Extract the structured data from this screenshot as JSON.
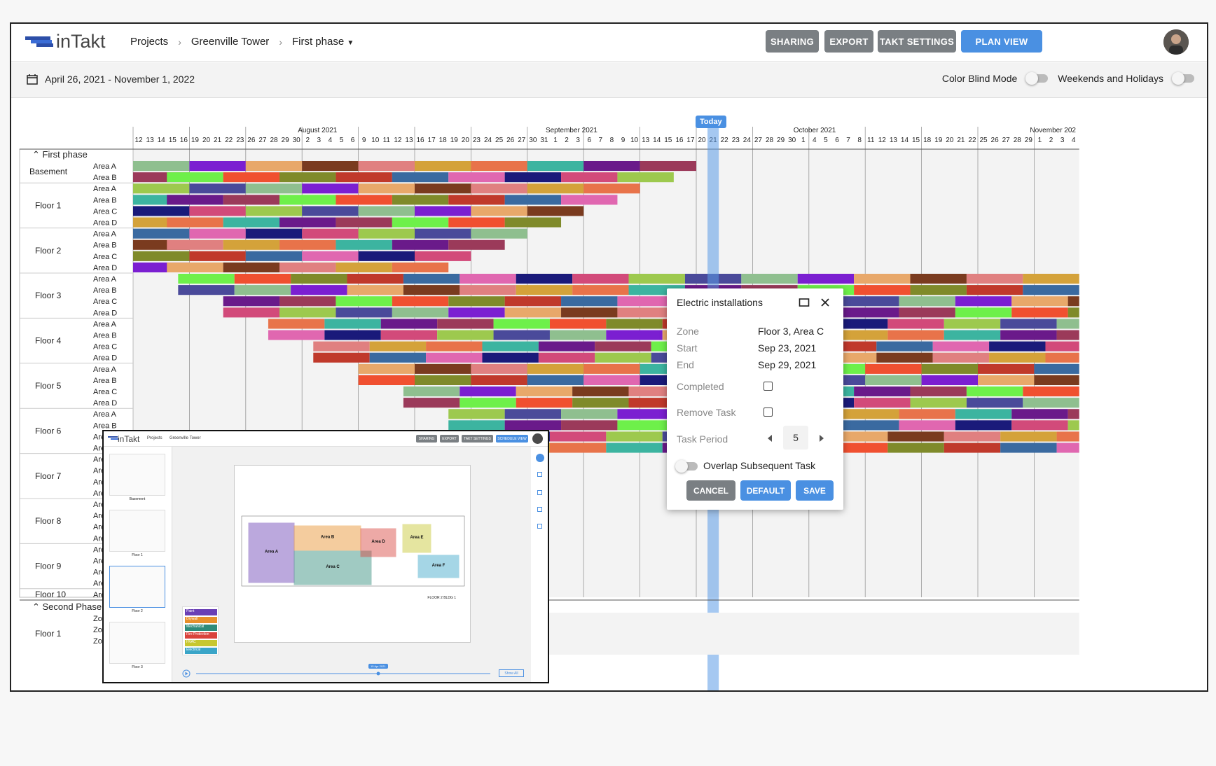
{
  "app": {
    "logo_text": "inTakt"
  },
  "breadcrumb": {
    "projects": "Projects",
    "project": "Greenville Tower",
    "phase": "First phase"
  },
  "header_buttons": {
    "sharing": "SHARING",
    "export": "EXPORT",
    "takt_settings": "TAKT SETTINGS",
    "plan_view": "PLAN VIEW"
  },
  "subbar": {
    "date_range": "April 26, 2021 - November 1, 2022",
    "color_blind": "Color Blind Mode",
    "weekends": "Weekends and Holidays"
  },
  "timeline": {
    "months": [
      "August 2021",
      "September 2021",
      "October 2021",
      "November 202"
    ],
    "days": [
      "12",
      "13",
      "14",
      "15",
      "16",
      "19",
      "20",
      "21",
      "22",
      "23",
      "26",
      "27",
      "28",
      "29",
      "30",
      "2",
      "3",
      "4",
      "5",
      "6",
      "9",
      "10",
      "11",
      "12",
      "13",
      "16",
      "17",
      "18",
      "19",
      "20",
      "23",
      "24",
      "25",
      "26",
      "27",
      "30",
      "31",
      "1",
      "2",
      "3",
      "6",
      "7",
      "8",
      "9",
      "10",
      "13",
      "14",
      "15",
      "16",
      "17",
      "20",
      "21",
      "22",
      "23",
      "24",
      "27",
      "28",
      "29",
      "30",
      "1",
      "4",
      "5",
      "6",
      "7",
      "8",
      "11",
      "12",
      "13",
      "14",
      "15",
      "18",
      "19",
      "20",
      "21",
      "22",
      "25",
      "26",
      "27",
      "28",
      "29",
      "1",
      "2",
      "3",
      "4"
    ],
    "today_label": "Today"
  },
  "phases": [
    {
      "name": "First phase"
    },
    {
      "name": "Second Phase"
    }
  ],
  "floors": [
    {
      "name": "Basement",
      "areas": [
        "Area A",
        "Area B"
      ]
    },
    {
      "name": "Floor 1",
      "areas": [
        "Area A",
        "Area B",
        "Area C",
        "Area D"
      ]
    },
    {
      "name": "Floor 2",
      "areas": [
        "Area A",
        "Area B",
        "Area C",
        "Area D"
      ]
    },
    {
      "name": "Floor 3",
      "areas": [
        "Area A",
        "Area B",
        "Area C",
        "Area D"
      ]
    },
    {
      "name": "Floor 4",
      "areas": [
        "Area A",
        "Area B",
        "Area C",
        "Area D"
      ]
    },
    {
      "name": "Floor 5",
      "areas": [
        "Area A",
        "Area B",
        "Area C",
        "Area D"
      ]
    },
    {
      "name": "Floor 6",
      "areas": [
        "Area A",
        "Area B",
        "Area C",
        "Area D"
      ]
    },
    {
      "name": "Floor 7",
      "areas": [
        "Are",
        "Are",
        "Are",
        "Are"
      ]
    },
    {
      "name": "Floor 8",
      "areas": [
        "Are",
        "Are",
        "Are",
        "Are"
      ]
    },
    {
      "name": "Floor 9",
      "areas": [
        "Are",
        "Are",
        "Are",
        "Are"
      ]
    },
    {
      "name": "Floor 10",
      "areas": [
        "Are"
      ]
    }
  ],
  "second_phase_floor": {
    "name": "Floor 1",
    "zones": [
      "Zo",
      "Zo",
      "Zo"
    ]
  },
  "task_dialog": {
    "title": "Electric installations",
    "zone_label": "Zone",
    "zone_value": "Floor 3, Area C",
    "start_label": "Start",
    "start_value": "Sep 23, 2021",
    "end_label": "End",
    "end_value": "Sep 29, 2021",
    "completed_label": "Completed",
    "remove_label": "Remove Task",
    "period_label": "Task Period",
    "period_value": "5",
    "overlap_label": "Overlap Subsequent Task",
    "cancel": "CANCEL",
    "default": "DEFAULT",
    "save": "SAVE"
  },
  "inset": {
    "logo_text": "inTakt",
    "crumb_projects": "Projects",
    "crumb_project": "Greenville Tower",
    "buttons": [
      "SHARING",
      "EXPORT",
      "TAKT SETTINGS",
      "SCHEDULE VIEW"
    ],
    "thumbs": [
      "Basement",
      "Floor 1",
      "Floor 2",
      "Floor 3"
    ],
    "areas": [
      "Area A",
      "Area B",
      "Area C",
      "Area D",
      "Area E",
      "Area F"
    ],
    "trades": [
      "Paint",
      "Drywall",
      "Mechanical",
      "Fire Protection",
      "HVAC",
      "Electrical"
    ],
    "trade_colors": [
      "#6a3fb5",
      "#e8902b",
      "#2e8b7a",
      "#d9423c",
      "#c7c72f",
      "#3aa5c8"
    ],
    "sheet_label": "FLOOR 2 BLDG 1",
    "slider_date": "15 Apr 2021",
    "period_select": "Show All"
  },
  "colors": {
    "accent": "#4a90e2",
    "gray_button": "#7a7f83",
    "today_column": "#8ab8ee"
  }
}
